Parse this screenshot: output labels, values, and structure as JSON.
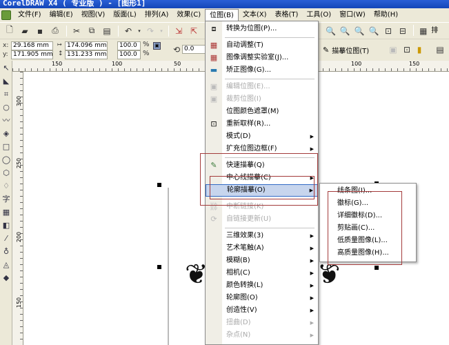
{
  "window": {
    "title": "CorelDRAW X4 ( 专业版 ) - [图形1]"
  },
  "menubar": {
    "items": [
      {
        "label": "文件(F)"
      },
      {
        "label": "编辑(E)"
      },
      {
        "label": "视图(V)"
      },
      {
        "label": "版面(L)"
      },
      {
        "label": "排列(A)"
      },
      {
        "label": "效果(C)"
      },
      {
        "label": "位图(B)"
      },
      {
        "label": "文本(X)"
      },
      {
        "label": "表格(T)"
      },
      {
        "label": "工具(O)"
      },
      {
        "label": "窗口(W)"
      },
      {
        "label": "帮助(H)"
      }
    ],
    "active": "位图(B)"
  },
  "toolbar": {
    "layout_label": "排版"
  },
  "propertybar": {
    "x_label": "x:",
    "x_value": "29.168 mm",
    "y_label": "y:",
    "y_value": "171.905 mm",
    "width_value": "174.096 mm",
    "height_value": "131.233 mm",
    "scale_x": "100.0",
    "scale_y": "100.0",
    "percent": "%",
    "rotation": "0.0",
    "trace_bitmap_label": "描摹位图(T)"
  },
  "rulers": {
    "top_ticks": [
      "150",
      "100",
      "50",
      "100",
      "150"
    ],
    "left_ticks": [
      "300",
      "250",
      "200",
      "150"
    ]
  },
  "bitmap_menu": {
    "items": [
      {
        "label": "转换为位图(P)...",
        "icon": "convert-bitmap-icon",
        "disabled": false,
        "submenu": false
      },
      {
        "label": "自动调整(T)",
        "icon": "auto-adjust-icon",
        "disabled": false,
        "submenu": false
      },
      {
        "label": "图像调整实验室(J)...",
        "icon": "image-lab-icon",
        "disabled": false,
        "submenu": false
      },
      {
        "label": "矫正图像(G)...",
        "icon": "straighten-icon",
        "disabled": false,
        "submenu": false
      },
      {
        "label": "编辑位图(E)...",
        "icon": "edit-bitmap-icon",
        "disabled": true,
        "submenu": false
      },
      {
        "label": "裁剪位图(I)",
        "icon": "crop-bitmap-icon",
        "disabled": true,
        "submenu": false
      },
      {
        "label": "位图颜色遮罩(M)",
        "icon": "",
        "disabled": false,
        "submenu": false
      },
      {
        "label": "重新取样(R)...",
        "icon": "resample-icon",
        "disabled": false,
        "submenu": false
      },
      {
        "label": "模式(D)",
        "icon": "",
        "disabled": false,
        "submenu": true
      },
      {
        "label": "扩充位图边框(F)",
        "icon": "",
        "disabled": false,
        "submenu": true
      },
      {
        "label": "快速描摹(Q)",
        "icon": "quick-trace-icon",
        "disabled": false,
        "submenu": false
      },
      {
        "label": "中心线描摹(C)",
        "icon": "",
        "disabled": false,
        "submenu": true
      },
      {
        "label": "轮廓描摹(O)",
        "icon": "",
        "disabled": false,
        "submenu": true,
        "highlighted": true
      },
      {
        "label": "中断链接(K)",
        "icon": "break-link-icon",
        "disabled": true,
        "submenu": false
      },
      {
        "label": "自链接更新(U)",
        "icon": "update-link-icon",
        "disabled": true,
        "submenu": false
      },
      {
        "label": "三维效果(3)",
        "icon": "",
        "disabled": false,
        "submenu": true
      },
      {
        "label": "艺术笔触(A)",
        "icon": "",
        "disabled": false,
        "submenu": true
      },
      {
        "label": "模糊(B)",
        "icon": "",
        "disabled": false,
        "submenu": true
      },
      {
        "label": "相机(C)",
        "icon": "",
        "disabled": false,
        "submenu": true
      },
      {
        "label": "颜色转换(L)",
        "icon": "",
        "disabled": false,
        "submenu": true
      },
      {
        "label": "轮廓图(O)",
        "icon": "",
        "disabled": false,
        "submenu": true
      },
      {
        "label": "创造性(V)",
        "icon": "",
        "disabled": false,
        "submenu": true
      },
      {
        "label": "扭曲(D)",
        "icon": "",
        "disabled": true,
        "submenu": true
      },
      {
        "label": "杂点(N)",
        "icon": "",
        "disabled": true,
        "submenu": true
      }
    ]
  },
  "outline_trace_submenu": {
    "items": [
      {
        "label": "线条图(I)..."
      },
      {
        "label": "徽标(G)..."
      },
      {
        "label": "详细徽标(D)..."
      },
      {
        "label": "剪贴画(C)..."
      },
      {
        "label": "低质量图像(L)..."
      },
      {
        "label": "高质量图像(H)..."
      }
    ]
  },
  "colors": {
    "titlebar": "#1446b8",
    "chrome": "#ece9d8",
    "highlight": "#c7d5ed",
    "annotation_box": "#a33a3a"
  }
}
